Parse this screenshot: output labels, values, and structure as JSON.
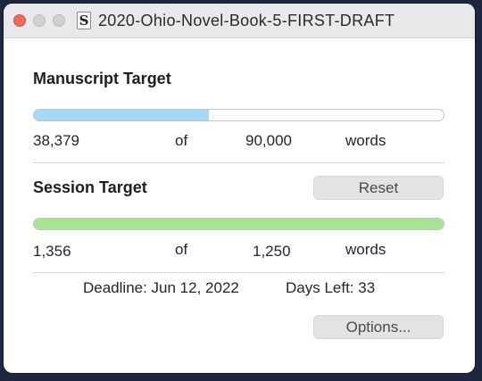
{
  "window": {
    "title": "2020-Ohio-Novel-Book-5-FIRST-DRAFT",
    "doc_icon_letter": "S"
  },
  "manuscript": {
    "heading": "Manuscript Target",
    "current": "38,379",
    "of_label": "of",
    "target": "90,000",
    "unit": "words",
    "progress_fraction": 0.426,
    "bar_color": "#a6d8f7"
  },
  "session": {
    "heading": "Session Target",
    "reset_label": "Reset",
    "current": "1,356",
    "of_label": "of",
    "target": "1,250",
    "unit": "words",
    "progress_fraction": 1.0,
    "bar_color": "#a8e393"
  },
  "footer": {
    "deadline": "Deadline: Jun 12, 2022",
    "days_left": "Days Left: 33",
    "options_label": "Options..."
  },
  "colors": {
    "close_button": "#ed6a5e",
    "inactive_button": "#d0d0d2",
    "background": "#1d2740"
  }
}
